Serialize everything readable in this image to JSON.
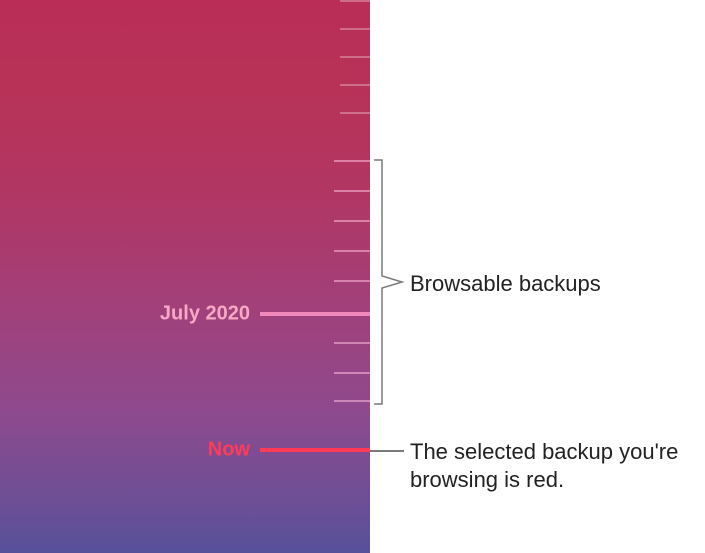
{
  "timeline": {
    "date_label": "July 2020",
    "now_label": "Now"
  },
  "callouts": {
    "browsable": "Browsable backups",
    "selected": "The selected backup you're browsing is red."
  },
  "colors": {
    "selected_tick": "#ff3b57",
    "bracket": "#7a7a7a"
  }
}
